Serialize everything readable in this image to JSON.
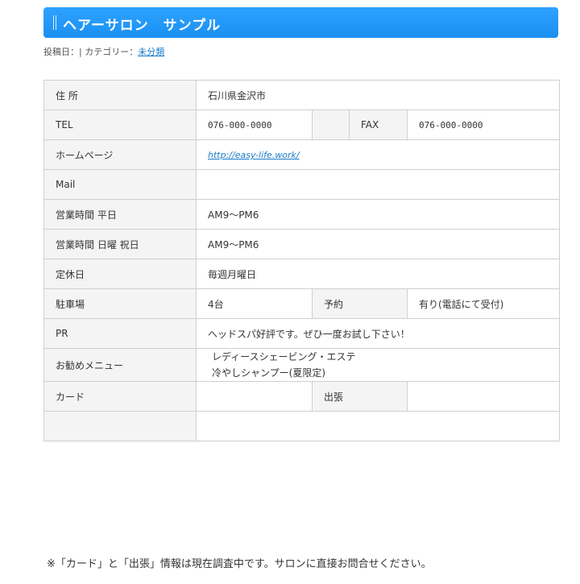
{
  "post": {
    "title": "ヘアーサロン　サンプル",
    "meta_prefix": "投稿日：| カテゴリー：",
    "category_link": "未分類"
  },
  "rows": {
    "address": {
      "label": "住 所",
      "value": "石川県金沢市"
    },
    "tel": {
      "label": "TEL",
      "value": "076-000-0000",
      "fax_label": "FAX",
      "fax_value": "076-000-0000"
    },
    "homepage": {
      "label": "ホームページ",
      "value": "http://easy-life.work/"
    },
    "mail": {
      "label": "Mail",
      "value": ""
    },
    "hours_weekday": {
      "label": "営業時間 平日",
      "value": "AM9～PM6"
    },
    "hours_holiday": {
      "label": "営業時間 日曜 祝日",
      "value": "AM9～PM6"
    },
    "closed": {
      "label": "定休日",
      "value": "毎週月曜日"
    },
    "parking": {
      "label": "駐車場",
      "value": "4台",
      "reserve_label": "予約",
      "reserve_value": "有り(電話にて受付)"
    },
    "pr": {
      "label": "PR",
      "value": "ヘッドスパ好評です。ぜひ一度お試し下さい！"
    },
    "menu": {
      "label": "お勧めメニュー",
      "items": [
        "レディースシェービング・エステ",
        "冷やしシャンプー(夏限定)"
      ]
    },
    "card": {
      "label": "カード",
      "value": "",
      "trip_label": "出張",
      "trip_value": ""
    },
    "blank": {
      "label": "",
      "value": ""
    }
  },
  "note": "※「カード」と「出張」情報は現在調査中です。サロンに直接お問合せください。"
}
